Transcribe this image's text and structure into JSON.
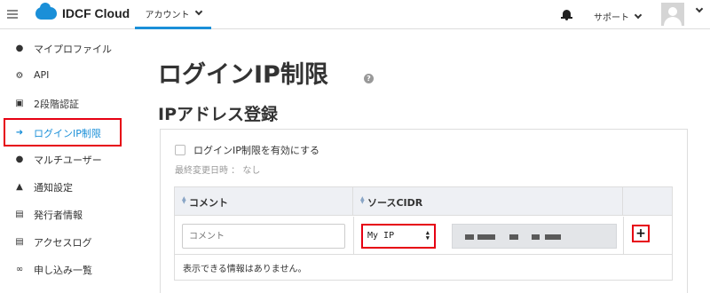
{
  "header": {
    "logo_text": "IDCF Cloud",
    "account_tab": "アカウント",
    "support_label": "サポート"
  },
  "sidebar": {
    "items": [
      {
        "label": "マイプロファイル",
        "icon": "user-icon"
      },
      {
        "label": "API",
        "icon": "gears-icon"
      },
      {
        "label": "2段階認証",
        "icon": "lock-icon"
      },
      {
        "label": "ログインIP制限",
        "icon": "sign-in-icon",
        "active": true
      },
      {
        "label": "マルチユーザー",
        "icon": "users-icon"
      },
      {
        "label": "通知設定",
        "icon": "bell-icon"
      },
      {
        "label": "発行者情報",
        "icon": "file-icon"
      },
      {
        "label": "アクセスログ",
        "icon": "file-icon"
      },
      {
        "label": "申し込み一覧",
        "icon": "handshake-icon"
      }
    ]
  },
  "main": {
    "page_title": "ログインIP制限",
    "section_title": "IPアドレス登録",
    "enable_label": "ログインIP制限を有効にする",
    "last_modified": "最終変更日時 ： なし",
    "table": {
      "columns": [
        "コメント",
        "ソースCIDR"
      ],
      "comment_placeholder": "コメント",
      "ip_select_value": "My IP",
      "add_label": "+",
      "empty_message": "表示できる情報はありません。"
    }
  },
  "colors": {
    "accent": "#1a8fd8",
    "highlight_red": "#e60012",
    "table_header_bg": "#eef0f4"
  }
}
